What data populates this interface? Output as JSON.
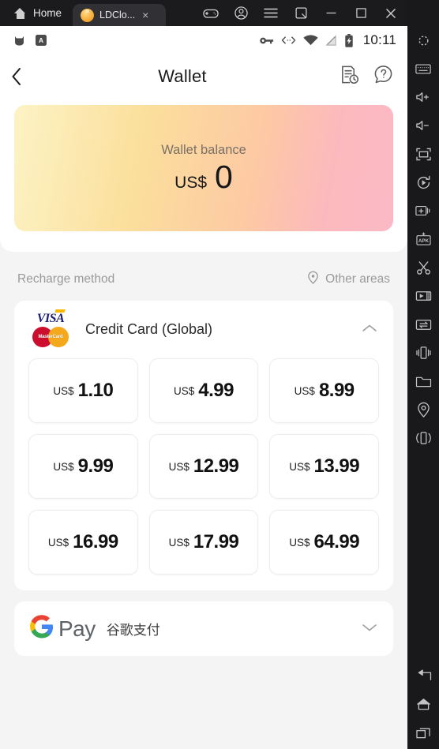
{
  "emulator": {
    "home_label": "Home",
    "tab": {
      "title": "LDClo...",
      "close_label": "×",
      "icon": "app-icon"
    },
    "window_buttons": [
      {
        "name": "gamepad-icon",
        "label": ""
      },
      {
        "name": "account-icon",
        "label": ""
      },
      {
        "name": "menu-icon",
        "label": ""
      },
      {
        "name": "multi-instance-icon",
        "label": ""
      },
      {
        "name": "minimize-icon",
        "label": ""
      },
      {
        "name": "maximize-icon",
        "label": ""
      },
      {
        "name": "close-icon",
        "label": ""
      },
      {
        "name": "collapse-icon",
        "label": ""
      }
    ],
    "sidebar_icons": [
      "settings-gear-icon",
      "keyboard-icon",
      "volume-up-icon",
      "volume-down-icon",
      "fullscreen-icon",
      "rotate-icon",
      "add-instance-icon",
      "install-apk-icon",
      "screenshot-scissors-icon",
      "screen-record-icon",
      "file-transfer-icon",
      "shake-icon",
      "folder-icon",
      "location-icon",
      "vibrate-icon"
    ],
    "nav_icons": [
      "back-icon",
      "home-icon",
      "recents-icon"
    ]
  },
  "statusbar": {
    "left_icons": [
      "cat-app-icon",
      "keyboard-input-icon"
    ],
    "right_icons": [
      "vpn-key-icon",
      "usb-debug-icon",
      "wifi-icon",
      "signal-icon",
      "battery-charging-icon"
    ],
    "time": "10:11"
  },
  "header": {
    "back_icon": "chevron-left-icon",
    "title": "Wallet",
    "history_icon": "order-history-icon",
    "help_icon": "help-question-icon"
  },
  "balance": {
    "label": "Wallet balance",
    "currency": "US$",
    "value": "0",
    "gradient_from": "#FCF3C5",
    "gradient_mid": "#FBDF9C",
    "gradient_to": "#FBB9C6"
  },
  "recharge": {
    "section_title": "Recharge method",
    "other_areas_label": "Other areas",
    "other_areas_icon": "location-pin-icon"
  },
  "methods": [
    {
      "id": "credit-card-global",
      "name": "Credit Card (Global)",
      "brands": [
        "VISA",
        "MasterCard"
      ],
      "expanded": true,
      "chevron": "chevron-up-icon",
      "prices": [
        {
          "currency": "US$",
          "amount": "1.10"
        },
        {
          "currency": "US$",
          "amount": "4.99"
        },
        {
          "currency": "US$",
          "amount": "8.99"
        },
        {
          "currency": "US$",
          "amount": "9.99"
        },
        {
          "currency": "US$",
          "amount": "12.99"
        },
        {
          "currency": "US$",
          "amount": "13.99"
        },
        {
          "currency": "US$",
          "amount": "16.99"
        },
        {
          "currency": "US$",
          "amount": "17.99"
        },
        {
          "currency": "US$",
          "amount": "64.99"
        }
      ]
    },
    {
      "id": "google-pay",
      "logo_text": "Pay",
      "name": "谷歌支付",
      "expanded": false,
      "chevron": "chevron-down-icon"
    }
  ]
}
